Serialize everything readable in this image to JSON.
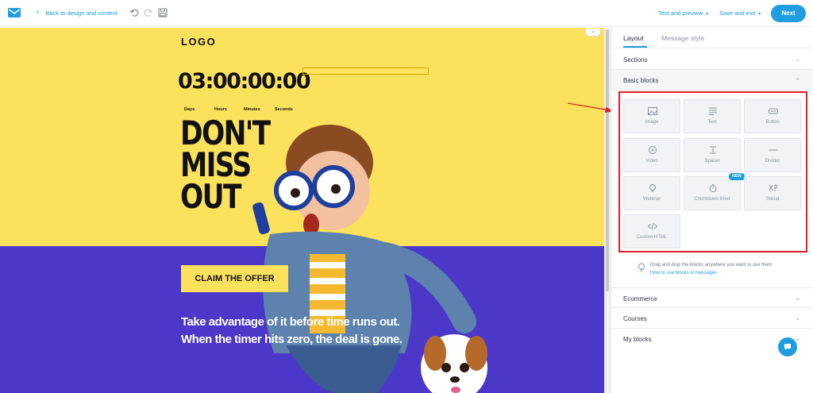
{
  "topbar": {
    "back_label": "Back to design and content",
    "test_preview_label": "Test and preview",
    "save_exit_label": "Save and exit",
    "next_label": "Next"
  },
  "email": {
    "logo_text": "LOGO",
    "timer_value": "03:00:00:00",
    "timer_labels": [
      "Days",
      "Hours",
      "Minutes",
      "Seconds"
    ],
    "headline_lines": [
      "DON'T",
      "MISS",
      "OUT"
    ],
    "cta_label": "CLAIM THE OFFER",
    "body_lines": [
      "Take advantage of it before time runs out.",
      "When the timer hits zero, the deal is gone."
    ]
  },
  "panel": {
    "tabs": [
      {
        "label": "Layout",
        "active": true
      },
      {
        "label": "Message style",
        "active": false
      }
    ],
    "sections_label": "Sections",
    "basic_blocks_label": "Basic blocks",
    "blocks": [
      {
        "label": "Image",
        "icon": "image-icon"
      },
      {
        "label": "Text",
        "icon": "text-icon"
      },
      {
        "label": "Button",
        "icon": "button-icon"
      },
      {
        "label": "Video",
        "icon": "video-icon"
      },
      {
        "label": "Spacer",
        "icon": "spacer-icon"
      },
      {
        "label": "Divider",
        "icon": "divider-icon"
      },
      {
        "label": "Webinar",
        "icon": "webinar-icon"
      },
      {
        "label": "Countdown timer",
        "icon": "timer-icon",
        "badge": "NEW"
      },
      {
        "label": "Social",
        "icon": "social-icon"
      },
      {
        "label": "Custom HTML",
        "icon": "code-icon"
      }
    ],
    "tip_text": "Drag and drop the blocks anywhere you want to use them",
    "tip_link": "How to use blocks in messages",
    "ecommerce_label": "Ecommerce",
    "courses_label": "Courses",
    "my_blocks_label": "My blocks"
  },
  "colors": {
    "accent": "#1e9de0",
    "email_yellow": "#fce25c",
    "email_purple": "#4b37c8",
    "highlight_red": "#e21d24"
  }
}
